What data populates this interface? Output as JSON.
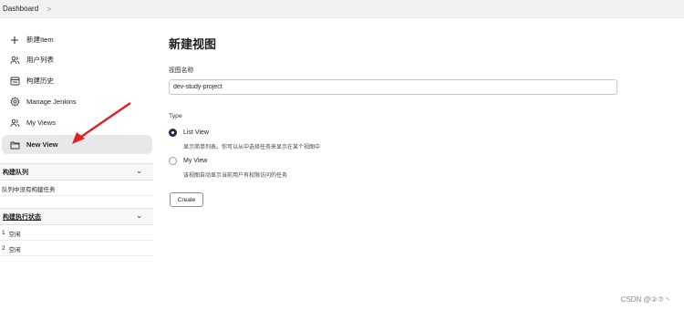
{
  "breadcrumb": {
    "items": [
      "Dashboard"
    ],
    "separator": ">"
  },
  "sidebar": {
    "tasks": [
      {
        "label": "新建Item",
        "icon": "plus-icon"
      },
      {
        "label": "用户列表",
        "icon": "people-icon"
      },
      {
        "label": "构建历史",
        "icon": "history-icon"
      },
      {
        "label": "Manage Jenkins",
        "icon": "gear-icon"
      },
      {
        "label": "My Views",
        "icon": "people-icon"
      },
      {
        "label": "New View",
        "icon": "folder-icon",
        "active": true
      }
    ],
    "build_queue": {
      "title": "构建队列",
      "empty_text": "队列中没有构建任务"
    },
    "executors": {
      "title": "构建执行状态",
      "rows": [
        {
          "number": "1",
          "status": "空闲"
        },
        {
          "number": "2",
          "status": "空闲"
        }
      ]
    }
  },
  "main": {
    "title": "新建视图",
    "name_label": "视图名称",
    "name_value": "dev-study-project",
    "type_label": "Type",
    "options": [
      {
        "label": "List View",
        "description": "显示简单列表。你可以从中选择任务来显示在某个视图中",
        "checked": true
      },
      {
        "label": "My View",
        "description": "该视图自动显示当前用户有权限访问的任务",
        "checked": false
      }
    ],
    "create_label": "Create"
  },
  "watermark": "CSDN @②⑦丶",
  "annotation": {
    "arrow_color": "#e02020"
  }
}
